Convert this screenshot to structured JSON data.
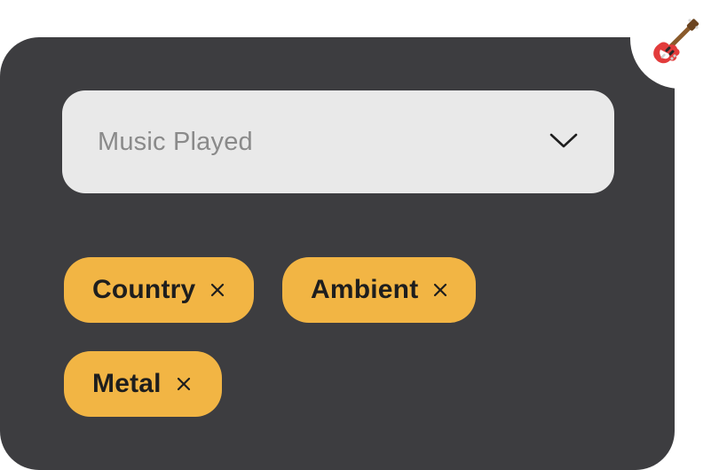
{
  "app": {
    "badge_icon": "electric-guitar-icon"
  },
  "filter": {
    "dropdown_placeholder": "Music Played",
    "dropdown_icon": "chevron-down-icon"
  },
  "selected_genres": [
    {
      "label": "Country"
    },
    {
      "label": "Ambient"
    },
    {
      "label": "Metal"
    }
  ],
  "colors": {
    "panel_bg": "#3d3d40",
    "dropdown_bg": "#e9e9e9",
    "chip_bg": "#f2b544",
    "chip_text": "#1e1e1e",
    "placeholder_text": "#8a8a8a",
    "guitar_body": "#e23b3b"
  }
}
